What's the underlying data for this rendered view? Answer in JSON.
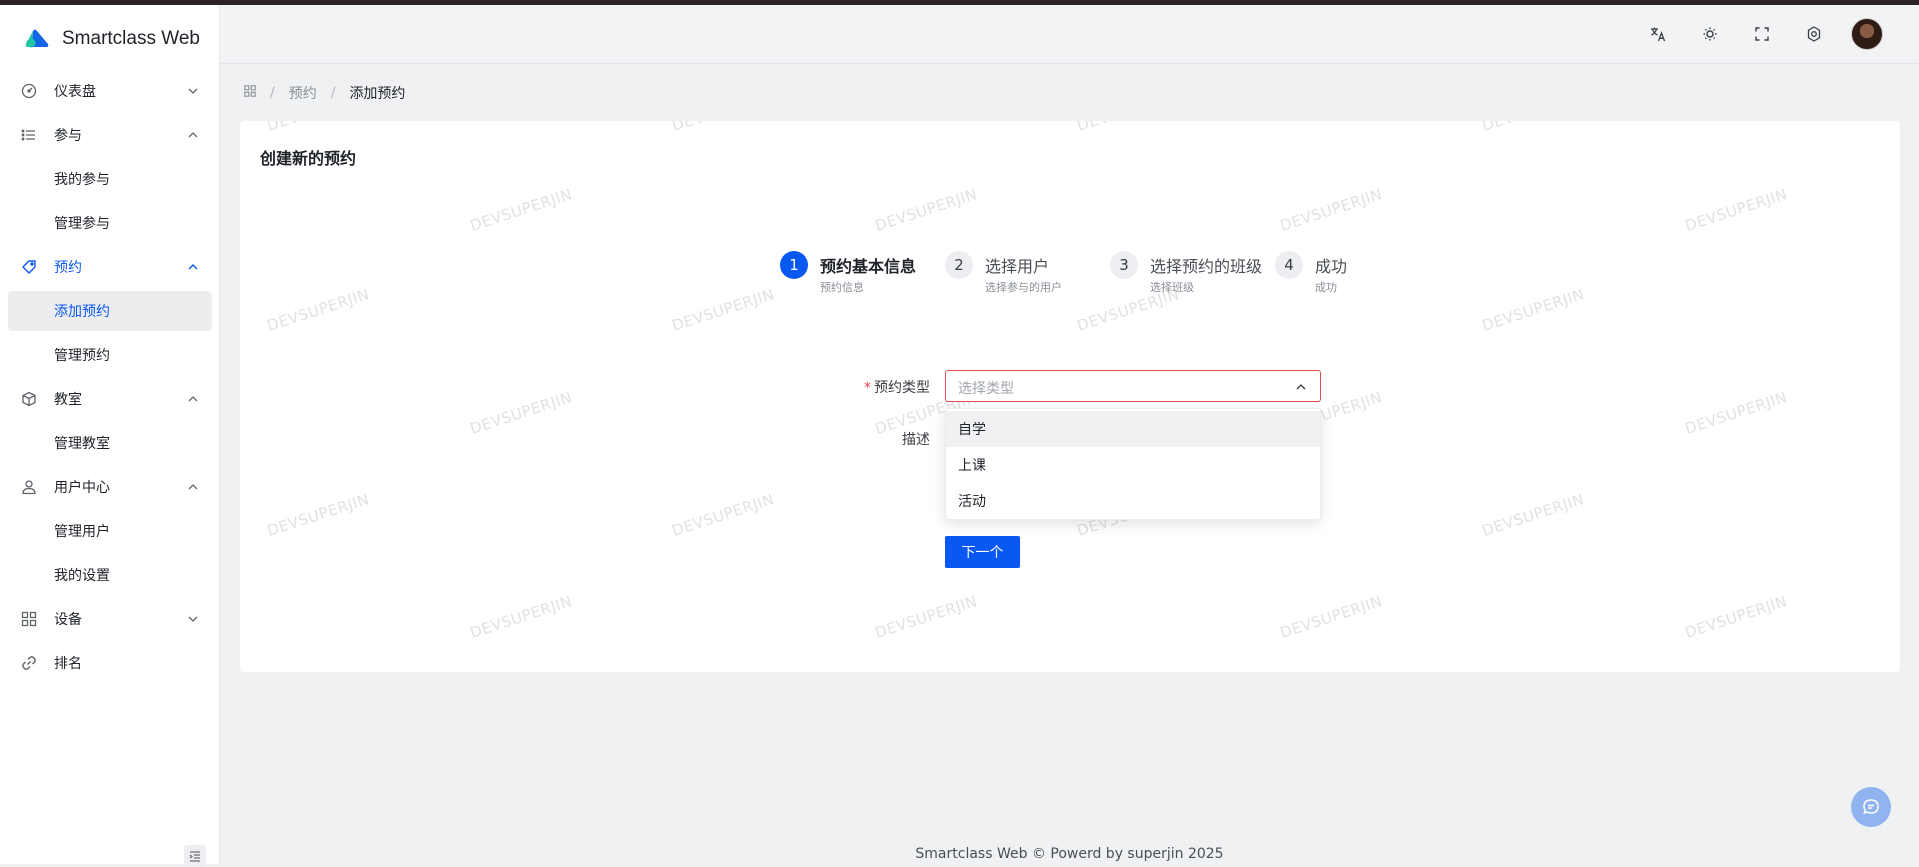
{
  "app": {
    "title": "Smartclass Web",
    "footer": "Smartclass Web © Powerd by superjin 2025"
  },
  "sidebar": {
    "items": [
      {
        "label": "仪表盘",
        "icon": "dashboard-icon"
      },
      {
        "label": "参与",
        "icon": "list-icon",
        "children": [
          "我的参与",
          "管理参与"
        ]
      },
      {
        "label": "预约",
        "icon": "tag-icon",
        "children": [
          "添加预约",
          "管理预约"
        ]
      },
      {
        "label": "教室",
        "icon": "cube-icon",
        "children": [
          "管理教室"
        ]
      },
      {
        "label": "用户中心",
        "icon": "user-icon",
        "children": [
          "管理用户",
          "我的设置"
        ]
      },
      {
        "label": "设备",
        "icon": "grid-icon"
      },
      {
        "label": "排名",
        "icon": "link-icon"
      }
    ],
    "selected": "添加预约"
  },
  "breadcrumb": {
    "items": [
      "预约",
      "添加预约"
    ]
  },
  "card": {
    "title": "创建新的预约"
  },
  "steps": [
    {
      "number": "1",
      "title": "预约基本信息",
      "desc": "预约信息"
    },
    {
      "number": "2",
      "title": "选择用户",
      "desc": "选择参与的用户"
    },
    {
      "number": "3",
      "title": "选择预约的班级",
      "desc": "选择班级"
    },
    {
      "number": "4",
      "title": "成功",
      "desc": "成功"
    }
  ],
  "form": {
    "type_label": "预约类型",
    "type_placeholder": "选择类型",
    "desc_label": "描述",
    "options": [
      "自学",
      "上课",
      "活动"
    ],
    "next_button": "下一个"
  },
  "watermark": "DEVSUPERJIN",
  "colors": {
    "primary": "#0a58f2",
    "error": "#e5484d"
  }
}
